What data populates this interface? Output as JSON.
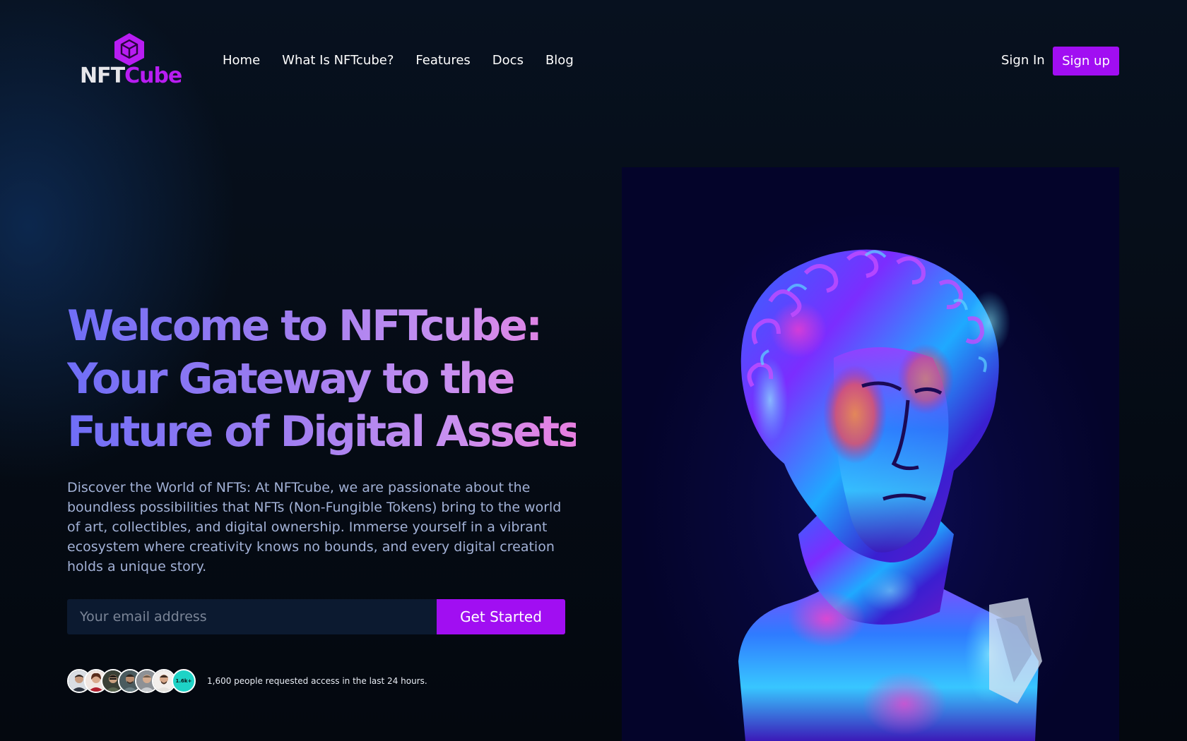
{
  "brand": {
    "logo_word_1": "NFT",
    "logo_word_2": "Cube",
    "logo_icon": "cube-icon",
    "accent_color": "#a10ef2"
  },
  "nav": {
    "items": [
      {
        "label": "Home"
      },
      {
        "label": "What Is NFTcube?"
      },
      {
        "label": "Features"
      },
      {
        "label": "Docs"
      },
      {
        "label": "Blog"
      }
    ],
    "signin_label": "Sign In",
    "signup_label": "Sign up"
  },
  "hero": {
    "headline_lines": [
      "Welcome to NFTcube:",
      "Your Gateway to the",
      "Future of Digital Assets!"
    ],
    "description": "Discover the World of NFTs: At NFTcube, we are passionate about the boundless possibilities that NFTs (Non-Fungible Tokens) bring to the world of art, collectibles, and digital ownership. Immerse yourself in a vibrant ecosystem where creativity knows no bounds, and every digital creation holds a unique story.",
    "email_placeholder": "Your email address",
    "cta_label": "Get Started",
    "avatar_count_label": "1.6k+",
    "social_proof_text": "1,600 people requested access in the last 24 hours."
  }
}
